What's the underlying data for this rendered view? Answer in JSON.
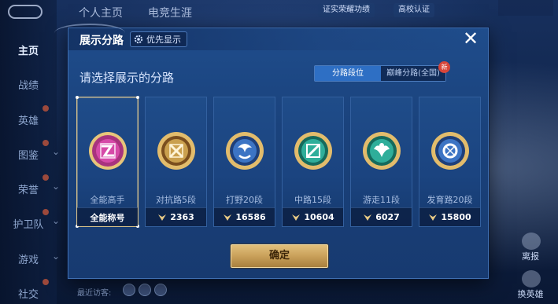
{
  "background": {
    "top_tabs": [
      "个人主页",
      "电竞生涯"
    ],
    "top_badges": [
      "证实荣耀功绩",
      "高校认证"
    ],
    "sidebar": [
      "主页",
      "战绩",
      "英雄",
      "图鉴",
      "荣誉",
      "护卫队",
      "游戏",
      "社交"
    ],
    "recent_label": "最近访客:",
    "right_labels": [
      "离报",
      "换英雄"
    ]
  },
  "modal": {
    "title": "展示分路",
    "priority_label": "优先显示",
    "close_glyph": "✕",
    "subtitle": "请选择展示的分路",
    "segment": {
      "active": "分路段位",
      "inactive": "巅峰分路(全国)",
      "new_badge": "新"
    },
    "cards": [
      {
        "name": "全能高手",
        "foot": "全能称号",
        "points": "",
        "icon": "all-round-badge-icon",
        "color": "#c73c9c",
        "selected": true
      },
      {
        "name": "对抗路5段",
        "foot": "",
        "points": "2363",
        "icon": "clash-lane-badge-icon",
        "color": "#d9a84a",
        "selected": false
      },
      {
        "name": "打野20段",
        "foot": "",
        "points": "16586",
        "icon": "jungle-badge-icon",
        "color": "#3c74c4",
        "selected": false
      },
      {
        "name": "中路15段",
        "foot": "",
        "points": "10604",
        "icon": "mid-lane-badge-icon",
        "color": "#2fae9a",
        "selected": false
      },
      {
        "name": "游走11段",
        "foot": "",
        "points": "6027",
        "icon": "roam-badge-icon",
        "color": "#2fae9a",
        "selected": false
      },
      {
        "name": "发育路20段",
        "foot": "",
        "points": "15800",
        "icon": "farm-lane-badge-icon",
        "color": "#3c74c4",
        "selected": false
      }
    ],
    "confirm_label": "确定"
  }
}
